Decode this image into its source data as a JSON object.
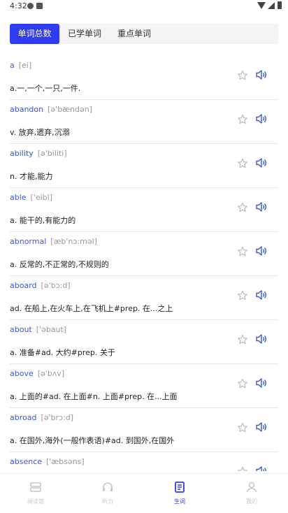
{
  "status_bar": {
    "time": "4:32"
  },
  "tabs": [
    {
      "label": "单词总数",
      "active": true
    },
    {
      "label": "已学单词",
      "active": false
    },
    {
      "label": "重点单词",
      "active": false
    }
  ],
  "words": [
    {
      "word": "a",
      "phonetic": "[ei]",
      "definition": "a.一,一个,一只,一件."
    },
    {
      "word": "abandon",
      "phonetic": "[ə'bændən]",
      "definition": "v. 放弃,遗弃,沉溺"
    },
    {
      "word": "ability",
      "phonetic": "[ə'biliti]",
      "definition": "n. 才能,能力"
    },
    {
      "word": "able",
      "phonetic": "['eibl]",
      "definition": "a. 能干的,有能力的"
    },
    {
      "word": "abnormal",
      "phonetic": "[æb'nɔ:məl]",
      "definition": "a. 反常的,不正常的,不规则的"
    },
    {
      "word": "aboard",
      "phonetic": "[ə'bɔ:d]",
      "definition": "ad. 在船上,在火车上,在飞机上#prep. 在...之上"
    },
    {
      "word": "about",
      "phonetic": "['əbaut]",
      "definition": "a. 准备#ad. 大约#prep. 关于"
    },
    {
      "word": "above",
      "phonetic": "[ə'bʌv]",
      "definition": "a. 上面的#ad. 在上面#n. 上面#prep. 在...上面"
    },
    {
      "word": "abroad",
      "phonetic": "[ə'brɔ:d]",
      "definition": "a. 在国外,海外(一般作表语)#ad. 到国外,在国外"
    },
    {
      "word": "absence",
      "phonetic": "['æbsəns]",
      "definition": ""
    }
  ],
  "bottom_nav": [
    {
      "label": "阅读馆",
      "icon": "layers-icon",
      "active": false
    },
    {
      "label": "听力",
      "icon": "headphones-icon",
      "active": false
    },
    {
      "label": "生词",
      "icon": "book-icon",
      "active": true
    },
    {
      "label": "我的",
      "icon": "person-icon",
      "active": false
    }
  ],
  "colors": {
    "accent": "#2f3cf0",
    "word": "#3a57d6",
    "icon": "#3a57d6"
  }
}
